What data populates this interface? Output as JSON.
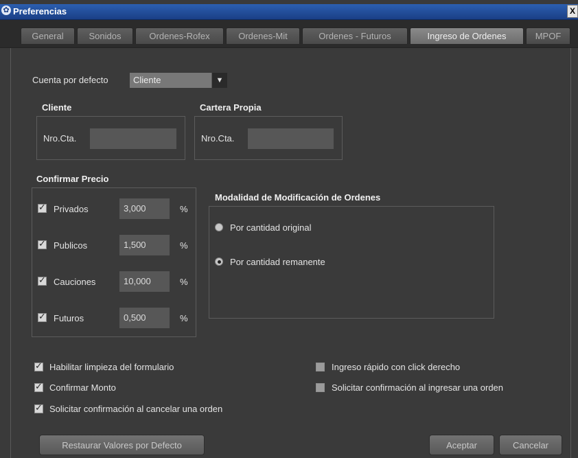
{
  "window": {
    "title": "Preferencias",
    "close_glyph": "X"
  },
  "tabs": [
    {
      "label": "General",
      "active": false
    },
    {
      "label": "Sonidos",
      "active": false
    },
    {
      "label": "Ordenes-Rofex",
      "active": false
    },
    {
      "label": "Ordenes-Mit",
      "active": false
    },
    {
      "label": "Ordenes - Futuros",
      "active": false
    },
    {
      "label": "Ingreso de Ordenes",
      "active": true
    },
    {
      "label": "MPOF",
      "active": false
    }
  ],
  "cuenta_defecto": {
    "label": "Cuenta por defecto",
    "value": "Cliente"
  },
  "cliente": {
    "title": "Cliente",
    "nro_label": "Nro.Cta.",
    "nro_value": ""
  },
  "cartera": {
    "title": "Cartera Propia",
    "nro_label": "Nro.Cta.",
    "nro_value": ""
  },
  "confirmar_precio": {
    "title": "Confirmar Precio",
    "rows": [
      {
        "label": "Privados",
        "value": "3,000",
        "unit": "%",
        "checked": true
      },
      {
        "label": "Publicos",
        "value": "1,500",
        "unit": "%",
        "checked": true
      },
      {
        "label": "Cauciones",
        "value": "10,000",
        "unit": "%",
        "checked": true
      },
      {
        "label": "Futuros",
        "value": "0,500",
        "unit": "%",
        "checked": true
      }
    ]
  },
  "modalidad": {
    "title": "Modalidad de Modificación de Ordenes",
    "options": [
      {
        "label": "Por cantidad original",
        "selected": false
      },
      {
        "label": "Por cantidad remanente",
        "selected": true
      }
    ]
  },
  "opciones": {
    "habilitar_limpieza": {
      "label": "Habilitar limpieza del formulario",
      "checked": true
    },
    "confirmar_monto": {
      "label": "Confirmar Monto",
      "checked": true
    },
    "confirmar_cancelar": {
      "label": "Solicitar confirmación al cancelar una orden",
      "checked": true
    },
    "ingreso_rapido": {
      "label": "Ingreso rápido con click derecho",
      "checked": false
    },
    "confirmar_ingresar": {
      "label": "Solicitar confirmación al ingresar una orden",
      "checked": false
    }
  },
  "buttons": {
    "restaurar": "Restaurar Valores por Defecto",
    "aceptar": "Aceptar",
    "cancelar": "Cancelar"
  },
  "icons": {
    "window_icon": "gear-icon",
    "combo_arrow": "triangle-down-icon"
  }
}
